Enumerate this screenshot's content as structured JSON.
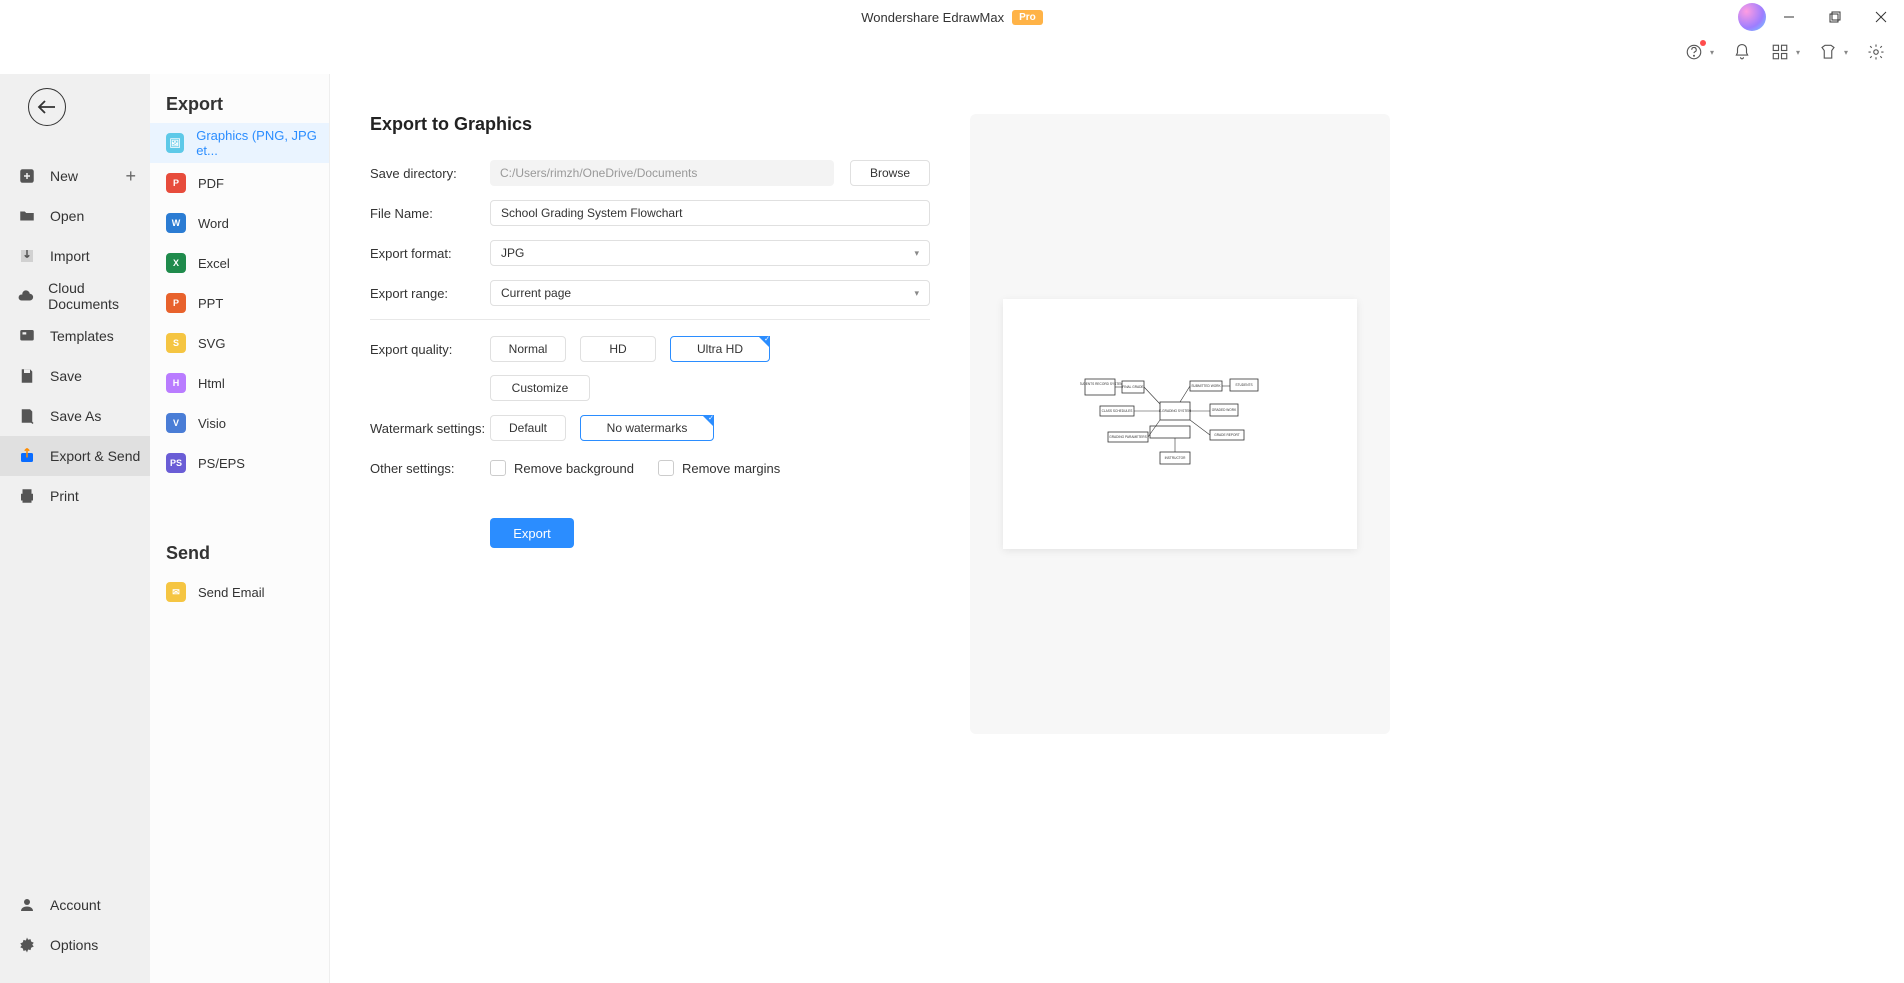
{
  "titlebar": {
    "title": "Wondershare EdrawMax",
    "badge": "Pro"
  },
  "nav": {
    "new": "New",
    "open": "Open",
    "import": "Import",
    "cloud": "Cloud Documents",
    "templates": "Templates",
    "save": "Save",
    "saveas": "Save As",
    "exportsend": "Export & Send",
    "print": "Print",
    "account": "Account",
    "options": "Options"
  },
  "secondary": {
    "export_heading": "Export",
    "graphics": "Graphics (PNG, JPG et...",
    "pdf": "PDF",
    "word": "Word",
    "excel": "Excel",
    "ppt": "PPT",
    "svg": "SVG",
    "html": "Html",
    "visio": "Visio",
    "pseps": "PS/EPS",
    "send_heading": "Send",
    "send_email": "Send Email"
  },
  "form": {
    "title": "Export to Graphics",
    "save_dir_label": "Save directory:",
    "save_dir_placeholder": "C:/Users/rimzh/OneDrive/Documents",
    "browse": "Browse",
    "filename_label": "File Name:",
    "filename_value": "School Grading System Flowchart",
    "format_label": "Export format:",
    "format_value": "JPG",
    "range_label": "Export range:",
    "range_value": "Current page",
    "quality_label": "Export quality:",
    "q_normal": "Normal",
    "q_hd": "HD",
    "q_uhd": "Ultra HD",
    "q_custom": "Customize",
    "watermark_label": "Watermark settings:",
    "w_default": "Default",
    "w_none": "No watermarks",
    "other_label": "Other settings:",
    "remove_bg": "Remove background",
    "remove_margins": "Remove margins",
    "export_btn": "Export"
  },
  "preview": {
    "nodes": {
      "n1": "STUDENTS RECORD SYSTEM",
      "n2": "FINAL GRADE",
      "n3": "SUBMITTED WORK",
      "n4": "STUDENTS",
      "n5": "CLASS SCHEDULES",
      "n6": "E-GRADING SYSTEM",
      "n7": "GRADED WORK",
      "n8": "GRADING PARAMETERS",
      "n9": "GRADE REPORT",
      "n10": "INSTRUCTOR"
    }
  }
}
